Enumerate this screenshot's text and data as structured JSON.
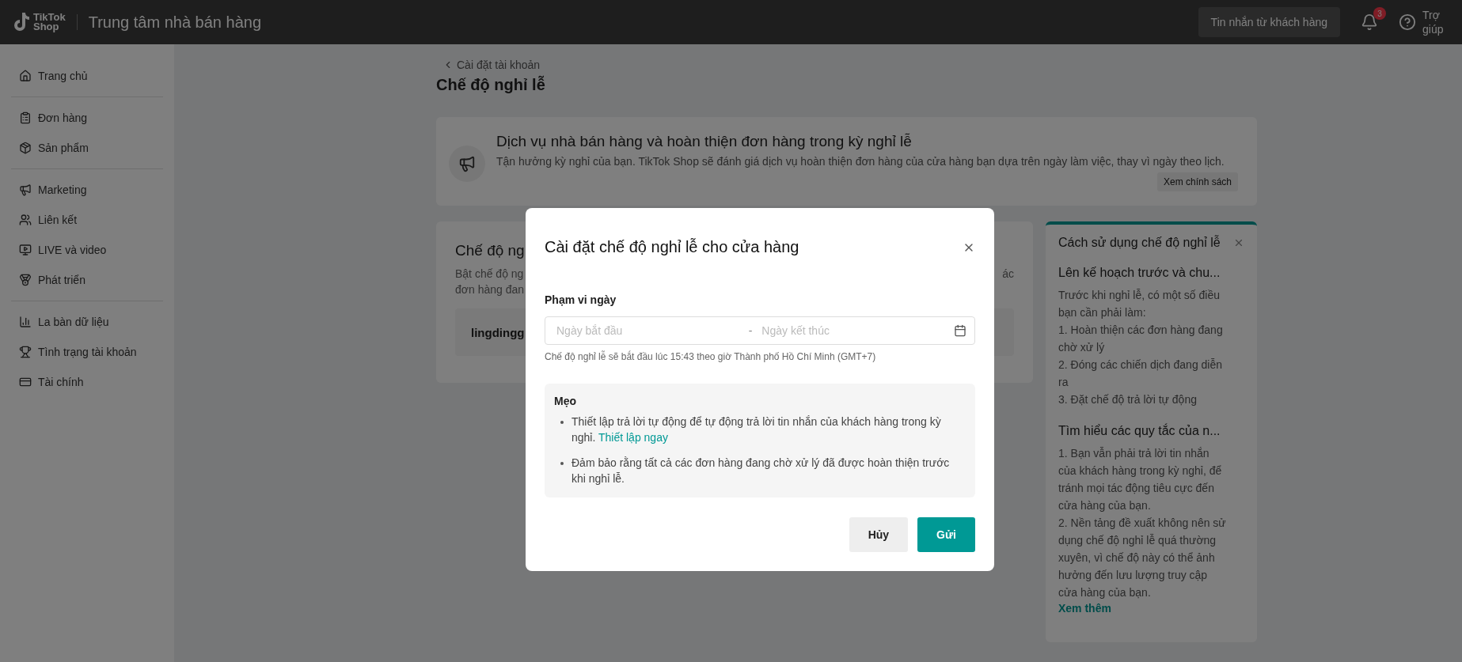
{
  "top_bar": {
    "logo_line1": "TikTok",
    "logo_line2": "Shop",
    "title": "Trung tâm nhà bán hàng",
    "messages_button": "Tin nhắn từ khách hàng",
    "notification_count": "3",
    "help": "Trợ giúp"
  },
  "sidebar": {
    "groups": [
      {
        "items": [
          {
            "label": "Trang chủ"
          }
        ]
      },
      {
        "items": [
          {
            "label": "Đơn hàng"
          },
          {
            "label": "Sản phẩm"
          }
        ]
      },
      {
        "items": [
          {
            "label": "Marketing"
          },
          {
            "label": "Liên kết"
          },
          {
            "label": "LIVE và video"
          },
          {
            "label": "Phát triển"
          }
        ]
      },
      {
        "items": [
          {
            "label": "La bàn dữ liệu"
          },
          {
            "label": "Tình trạng tài khoản"
          },
          {
            "label": "Tài chính"
          }
        ]
      }
    ]
  },
  "page": {
    "breadcrumb": "Cài đặt tài khoản",
    "title": "Chế độ nghỉ lễ"
  },
  "banner": {
    "title": "Dịch vụ nhà bán hàng và hoàn thiện đơn hàng trong kỳ nghỉ lễ",
    "text": "Tận hưởng kỳ nghỉ của bạn. TikTok Shop sẽ đánh giá dịch vụ hoàn thiện đơn hàng của cửa hàng bạn dựa trên ngày làm việc, thay vì ngày theo lịch.",
    "button": "Xem chính sách"
  },
  "mode_card": {
    "title": "Chế độ ng",
    "description_lines": [
      "Bật chế độ ng",
      "đơn hàng đan"
    ],
    "description_right": "ác",
    "account": "lingdingg"
  },
  "guide_panel": {
    "title": "Cách sử dụng chế độ nghỉ lễ",
    "sections": [
      {
        "heading": "Lên kế hoạch trước và chu...",
        "lines": [
          "Trước khi nghỉ lễ, có một số điều bạn cần phải làm:",
          "1. Hoàn thiện các đơn hàng đang chờ xử lý",
          "2. Đóng các chiến dịch đang diễn ra",
          "3. Đặt chế độ trả lời tự động"
        ]
      },
      {
        "heading": "Tìm hiểu các quy tắc của n...",
        "lines": [
          "1. Bạn vẫn phải trả lời tin nhắn của khách hàng trong kỳ nghỉ, để tránh mọi tác động tiêu cực đến cửa hàng của bạn.",
          "2. Nền tảng đề xuất không nên sử dụng chế độ nghỉ lễ quá thường xuyên, vì chế độ này có thể ảnh hưởng đến lưu lượng truy cập cửa hàng của bạn."
        ]
      }
    ],
    "link": "Xem thêm"
  },
  "modal": {
    "title": "Cài đặt chế độ nghỉ lễ cho cửa hàng",
    "date_range": {
      "label": "Phạm vi ngày",
      "start_placeholder": "Ngày bắt đầu",
      "separator": "-",
      "end_placeholder": "Ngày kết thúc",
      "hint": "Chế độ nghỉ lễ sẽ bắt đầu lúc 15:43 theo giờ Thành phố Hồ Chí Minh (GMT+7)"
    },
    "tips": {
      "title": "Mẹo",
      "items": [
        {
          "text": "Thiết lập trả lời tự động để tự động trả lời tin nhắn của khách hàng trong kỳ nghỉ.",
          "link": "Thiết lập ngay"
        },
        {
          "text": "Đảm bảo rằng tất cả các đơn hàng đang chờ xử lý đã được hoàn thiện trước khi nghỉ lễ."
        }
      ]
    },
    "buttons": [
      {
        "label": "Hủy",
        "kind": "secondary"
      },
      {
        "label": "Gửi",
        "kind": "primary"
      }
    ]
  }
}
